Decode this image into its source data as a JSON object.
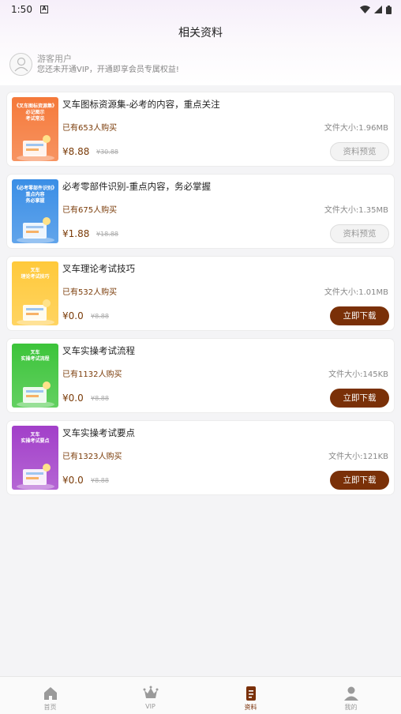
{
  "status_bar": {
    "time": "1:50",
    "notification": "A"
  },
  "header": {
    "title": "相关资料"
  },
  "user": {
    "name": "游客用户",
    "description": "您还未开通VIP，开通即享会员专属权益!"
  },
  "materials": [
    {
      "thumb_lines": [
        "《叉车图标资源集》",
        "必记图示",
        "考试常见"
      ],
      "thumb_color": "#f5793a",
      "title": "叉车图标资源集-必考的内容，重点关注",
      "buyers": "已有653人购买",
      "size": "文件大小:1.96MB",
      "price": "¥8.88",
      "original_price": "¥30.88",
      "action": "资料预览",
      "action_type": "preview"
    },
    {
      "thumb_lines": [
        "《必考零部件识别》",
        "重点内容",
        "务必掌握"
      ],
      "thumb_color": "#3a8ee6",
      "title": "必考零部件识别-重点内容，务必掌握",
      "buyers": "已有675人购买",
      "size": "文件大小:1.35MB",
      "price": "¥1.88",
      "original_price": "¥18.88",
      "action": "资料预览",
      "action_type": "preview"
    },
    {
      "thumb_lines": [
        "叉车",
        "理论考试技巧"
      ],
      "thumb_color": "#ffc93a",
      "title": "叉车理论考试技巧",
      "buyers": "已有532人购买",
      "size": "文件大小:1.01MB",
      "price": "¥0.0",
      "original_price": "¥8.88",
      "action": "立即下载",
      "action_type": "download"
    },
    {
      "thumb_lines": [
        "叉车",
        "实操考试流程"
      ],
      "thumb_color": "#3cc43a",
      "title": "叉车实操考试流程",
      "buyers": "已有1132人购买",
      "size": "文件大小:145KB",
      "price": "¥0.0",
      "original_price": "¥8.88",
      "action": "立即下载",
      "action_type": "download"
    },
    {
      "thumb_lines": [
        "叉车",
        "实操考试要点"
      ],
      "thumb_color": "#a23fc9",
      "title": "叉车实操考试要点",
      "buyers": "已有1323人购买",
      "size": "文件大小:121KB",
      "price": "¥0.0",
      "original_price": "¥8.88",
      "action": "立即下载",
      "action_type": "download"
    }
  ],
  "tabs": [
    {
      "label": "首页",
      "icon": "home-icon",
      "active": false
    },
    {
      "label": "VIP",
      "icon": "crown-icon",
      "active": false
    },
    {
      "label": "资料",
      "icon": "document-icon",
      "active": true
    },
    {
      "label": "我的",
      "icon": "person-icon",
      "active": false
    }
  ],
  "colors": {
    "accent": "#7a3008",
    "background": "#f4f4f6"
  }
}
